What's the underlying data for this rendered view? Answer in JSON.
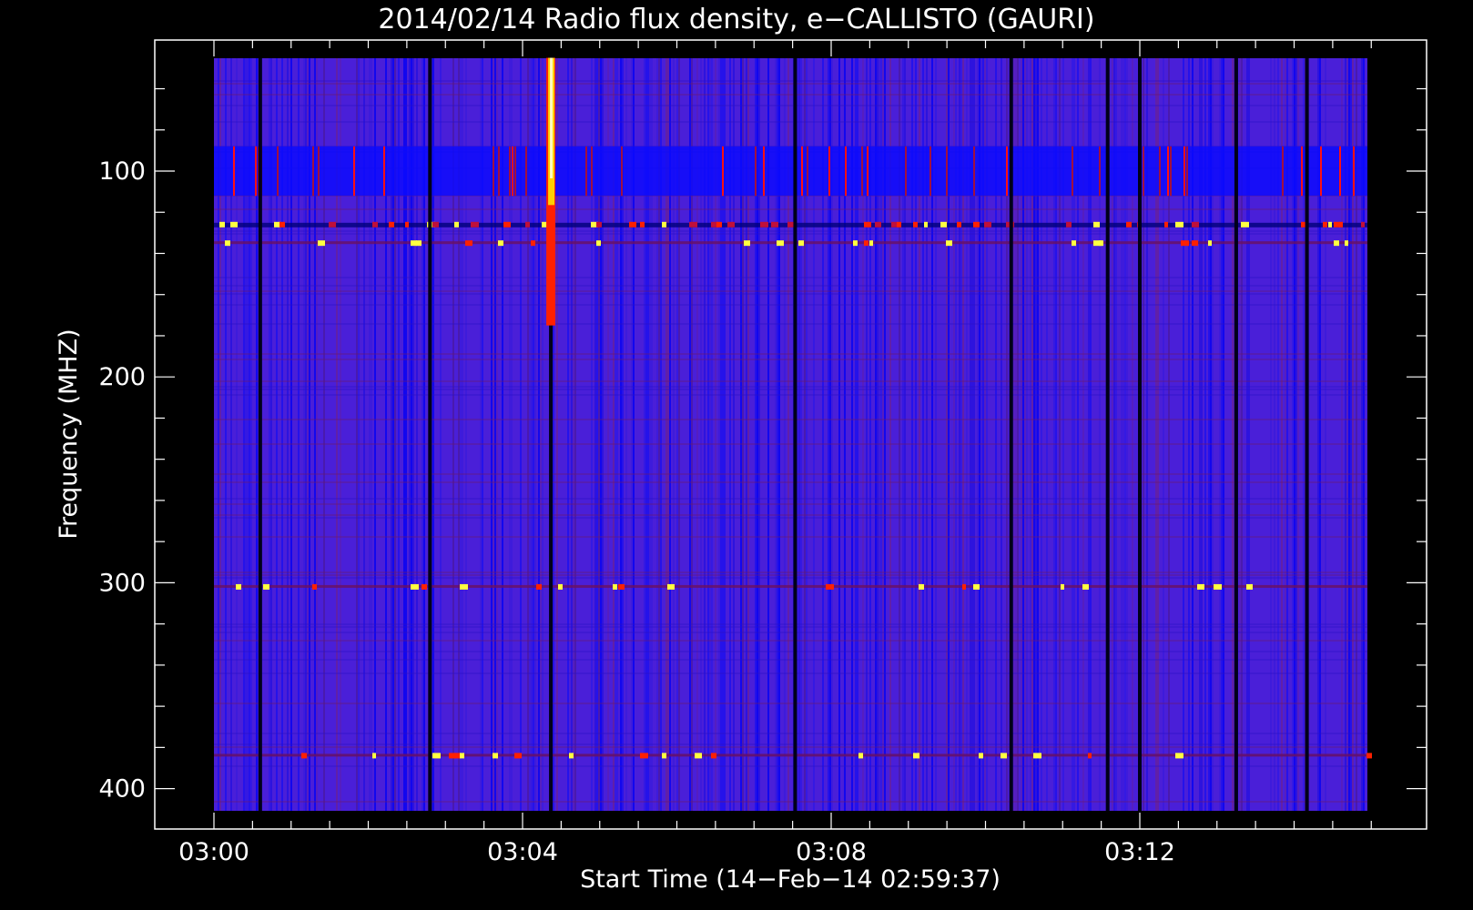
{
  "chart_data": {
    "type": "heatmap",
    "title": "2014/02/14  Radio flux density, e−CALLISTO (GAURI)",
    "xlabel": "Start Time (14−Feb−14 02:59:37)",
    "ylabel": "Frequency (MHZ)",
    "xlim": [
      "03:00",
      "03:15"
    ],
    "ylim": [
      410,
      45
    ],
    "y_inverted": true,
    "x_ticks": [
      "03:00",
      "03:04",
      "03:08",
      "03:12"
    ],
    "y_ticks": [
      100,
      200,
      300,
      400
    ],
    "colormap": [
      "#000000",
      "#0000ff",
      "#8b0040",
      "#ff0000",
      "#ffff00",
      "#ffffff"
    ],
    "background_color": "#000000",
    "features": {
      "burst": {
        "time": "03:04:22",
        "freq_range_mhz": [
          45,
          175
        ]
      },
      "bright_band_mhz": [
        88,
        112
      ],
      "rfi_lines_mhz": [
        126,
        135,
        302,
        384
      ],
      "dark_time_gaps": [
        "03:00:36",
        "03:02:48",
        "03:04:22",
        "03:07:32",
        "03:10:20",
        "03:11:35",
        "03:12:00",
        "03:13:15",
        "03:14:10"
      ]
    }
  }
}
